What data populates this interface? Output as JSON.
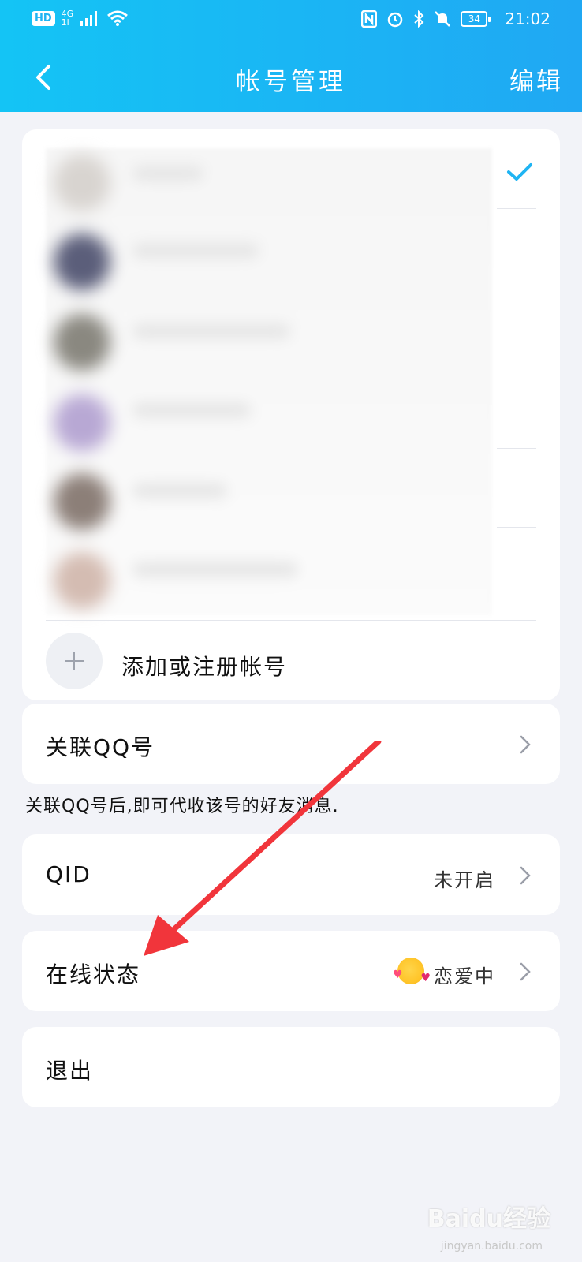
{
  "status_bar": {
    "network_badge": "HD",
    "signal_label": "4G",
    "signal_sub": "1l",
    "battery": "34",
    "time": "21:02"
  },
  "header": {
    "title": "帐号管理",
    "edit_label": "编辑"
  },
  "accounts_card": {
    "add_account_label": "添加或注册帐号"
  },
  "link_qq": {
    "label": "关联QQ号",
    "note": "关联QQ号后,即可代收该号的好友消息."
  },
  "qid": {
    "label": "QID",
    "value": "未开启"
  },
  "online_status": {
    "label": "在线状态",
    "value": "恋爱中",
    "emoji_icon": "love-emoji-icon"
  },
  "logout": {
    "label": "退出"
  },
  "watermark": {
    "brand": "Baidu经验",
    "url": "jingyan.baidu.com"
  },
  "colors": {
    "header_gradient_start": "#14c4f5",
    "header_gradient_end": "#20a8f3",
    "check_color": "#1fb4f3",
    "arrow_color": "#f1353b"
  }
}
